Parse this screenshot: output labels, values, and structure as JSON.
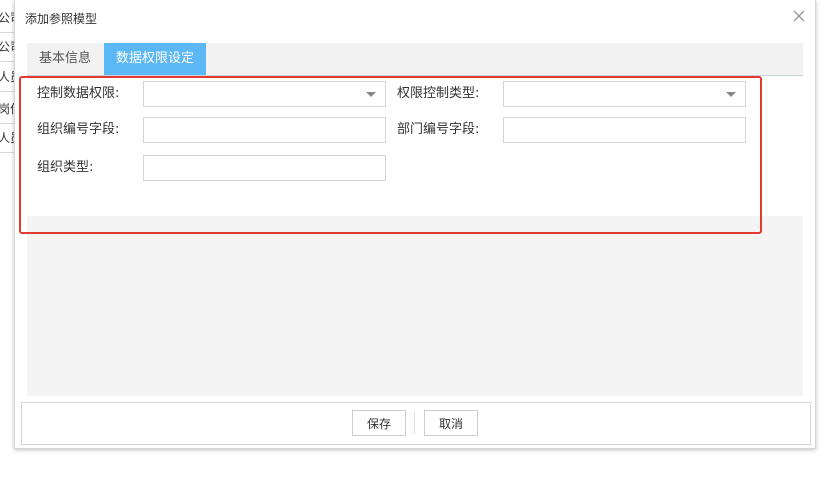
{
  "background": {
    "items": [
      "公司",
      "公司",
      "人员",
      "岗位",
      "人员"
    ]
  },
  "dialog": {
    "title": "添加参照模型",
    "close_icon": "close-icon"
  },
  "tabs": [
    {
      "label": "基本信息",
      "active": false
    },
    {
      "label": "数据权限设定",
      "active": true
    }
  ],
  "form": {
    "control_data_permission": {
      "label": "控制数据权限:",
      "value": ""
    },
    "permission_control_type": {
      "label": "权限控制类型:",
      "value": ""
    },
    "org_code_field": {
      "label": "组织编号字段:",
      "value": ""
    },
    "dept_code_field": {
      "label": "部门编号字段:",
      "value": ""
    },
    "org_type": {
      "label": "组织类型:",
      "value": ""
    }
  },
  "footer": {
    "save_label": "保存",
    "cancel_label": "取消"
  },
  "colors": {
    "active_tab": "#5cb8f5",
    "highlight_border": "#e33a2f"
  }
}
